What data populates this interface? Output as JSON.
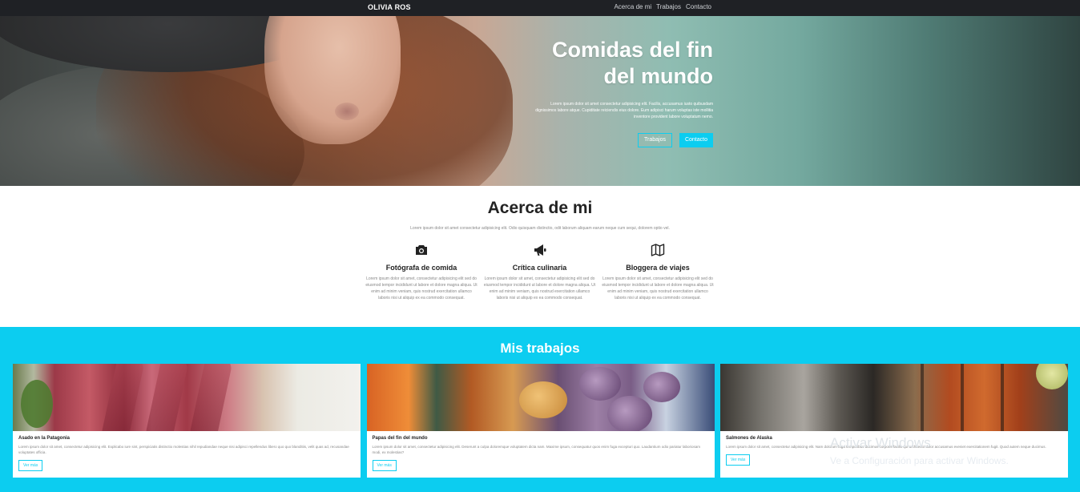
{
  "nav": {
    "brand": "OLIVIA ROS",
    "links": [
      "Acerca de mi",
      "Trabajos",
      "Contacto"
    ]
  },
  "hero": {
    "title_line1": "Comidas del fin",
    "title_line2": "del mundo",
    "text": "Lorem ipsum dolor sit amet consectetur adipisicing elit. Facilis, accusamus iusto quibusdam dignissimos labore atque. Cupiditate reiciendis eius dolore. Eum adipisci harum voluptas iste mollitia inventore provident labore voluptatum nemo.",
    "btn_works": "Trabajos",
    "btn_contact": "Contacto"
  },
  "about": {
    "title": "Acerca de mi",
    "lead": "Lorem ipsum dolor sit amet consectetur adipisicing elit. Odio quisquam distinctio, odit laborum aliquam earum neque cum sequi, dolorem optio vel.",
    "features": [
      {
        "icon": "camera-icon",
        "title": "Fotógrafa de comida",
        "text": "Lorem ipsum dolor sit amet, consectetur adipisicing elit sed do eiusmod tempor incididunt ut labore et dolore magna aliqua. Ut enim ad minim veniam, quis nostrud exercitation ullamco laboris nisi ut aliquip ex ea commodo consequat."
      },
      {
        "icon": "megaphone-icon",
        "title": "Crítica culinaria",
        "text": "Lorem ipsum dolor sit amet, consectetur adipisicing elit sed do eiusmod tempor incididunt ut labore et dolore magna aliqua. Ut enim ad minim veniam, quis nostrud exercitation ullamco laboris nisi ut aliquip ex ea commodo consequat."
      },
      {
        "icon": "map-icon",
        "title": "Bloggera de viajes",
        "text": "Lorem ipsum dolor sit amet, consectetur adipisicing elit sed do eiusmod tempor incididunt ut labore et dolore magna aliqua. Ut enim ad minim veniam, quis nostrud exercitation ullamco laboris nisi ut aliquip ex ea commodo consequat."
      }
    ]
  },
  "works": {
    "title": "Mis trabajos",
    "cards": [
      {
        "title": "Asado en la Patagonia",
        "text": "Lorem ipsum dolor sit amet, consectetur adipisicing elit. Explicabo iure sint, perspiciatis distinctio molestias nihil repudiandae neque nisi adipisci repellendus libero quo quo blanditiis, velit quas ad, recusandae voluptates officia.",
        "button": "Ver más"
      },
      {
        "title": "Papas del fin del mundo",
        "text": "Lorem ipsum dolor sit amet, consectetur adipisicing elit. Deserunt a culpa doloremque voluptatem dicta nam. Maxime ipsum, consequatur quos enim fuga excepturi quo. Laudantium odio pariatur laboriosam modi, ex molestias?",
        "button": "Ver más"
      },
      {
        "title": "Salmones de Alaska",
        "text": "Lorem ipsum dolor sit amet, consectetur adipisicing elit. Nam dolorum fuga temporibus ducimus corporis facilis qui architecto dolor accusamus eveniet exercitationem fugit. Quod autem neque ducimus.",
        "button": "Ver más"
      }
    ]
  },
  "watermark": {
    "title": "Activar Windows",
    "subtitle": "Ve a Configuración para activar Windows."
  },
  "colors": {
    "accent": "#0ccdf0",
    "nav_bg": "#1f2125",
    "text_dark": "#222222",
    "text_muted": "#888888"
  }
}
